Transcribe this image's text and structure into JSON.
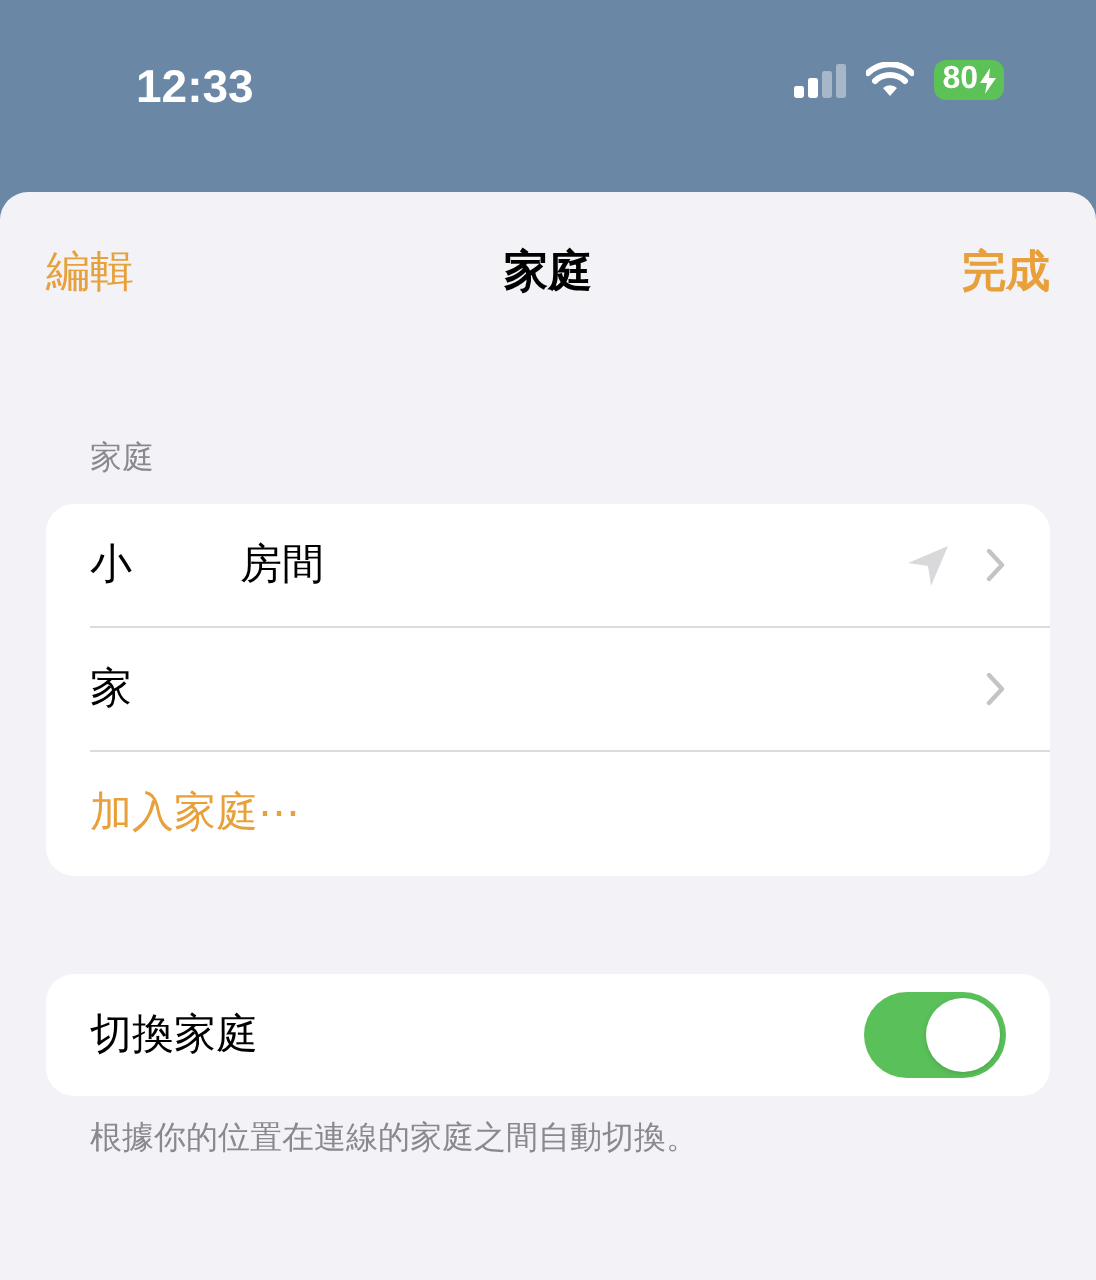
{
  "status_bar": {
    "time": "12:33",
    "battery": "80",
    "charging": true
  },
  "nav": {
    "left": "編輯",
    "title": "家庭",
    "right": "完成"
  },
  "homes_section": {
    "header": "家庭",
    "rows": [
      {
        "kind": "home",
        "label": "小",
        "label_tail": "房間",
        "current_location": true
      },
      {
        "kind": "home",
        "label": "家",
        "current_location": false
      },
      {
        "kind": "action",
        "label": "加入家庭⋯"
      }
    ]
  },
  "switch_row": {
    "label": "切換家庭",
    "on": true,
    "footer": "根據你的位置在連線的家庭之間自動切換。"
  }
}
